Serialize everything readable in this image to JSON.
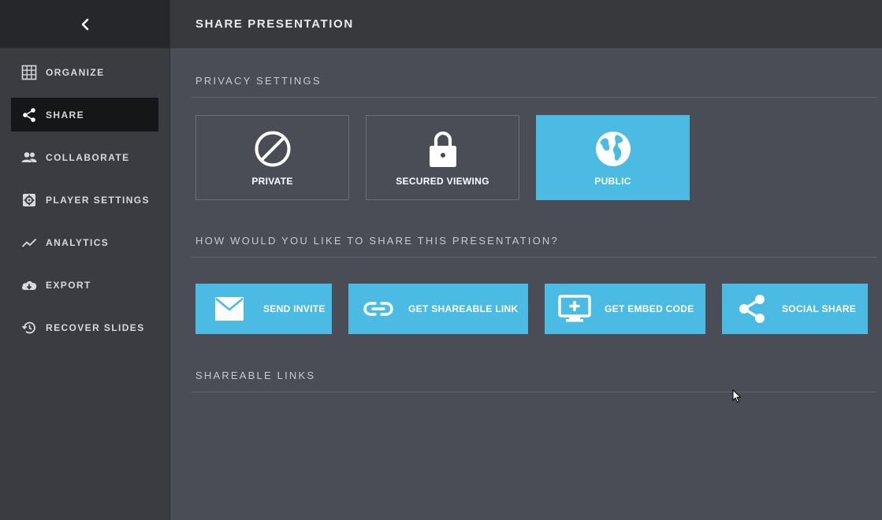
{
  "sidebar": {
    "items": [
      {
        "label": "ORGANIZE",
        "icon": "grid-icon"
      },
      {
        "label": "SHARE",
        "icon": "share-icon",
        "active": true
      },
      {
        "label": "COLLABORATE",
        "icon": "people-icon"
      },
      {
        "label": "PLAYER SETTINGS",
        "icon": "gear-icon"
      },
      {
        "label": "ANALYTICS",
        "icon": "trend-icon"
      },
      {
        "label": "EXPORT",
        "icon": "cloud-download-icon"
      },
      {
        "label": "RECOVER SLIDES",
        "icon": "history-icon"
      }
    ]
  },
  "header": {
    "title": "SHARE PRESENTATION"
  },
  "privacy": {
    "title": "PRIVACY SETTINGS",
    "options": [
      {
        "label": "PRIVATE",
        "icon": "block-icon"
      },
      {
        "label": "SECURED VIEWING",
        "icon": "lock-icon"
      },
      {
        "label": "PUBLIC",
        "icon": "globe-icon",
        "selected": true
      }
    ]
  },
  "share": {
    "title": "HOW WOULD YOU LIKE TO SHARE THIS PRESENTATION?",
    "buttons": [
      {
        "label": "SEND INVITE",
        "icon": "envelope-icon"
      },
      {
        "label": "GET SHAREABLE LINK",
        "icon": "link-icon"
      },
      {
        "label": "GET EMBED CODE",
        "icon": "embed-icon"
      },
      {
        "label": "SOCIAL SHARE",
        "icon": "share-icon"
      }
    ]
  },
  "links": {
    "title": "SHAREABLE LINKS"
  },
  "colors": {
    "accent": "#4bbbe3",
    "sidebar_bg": "#3a3c41",
    "main_bg": "#4a4d56",
    "topbar_bg": "#38393d"
  }
}
